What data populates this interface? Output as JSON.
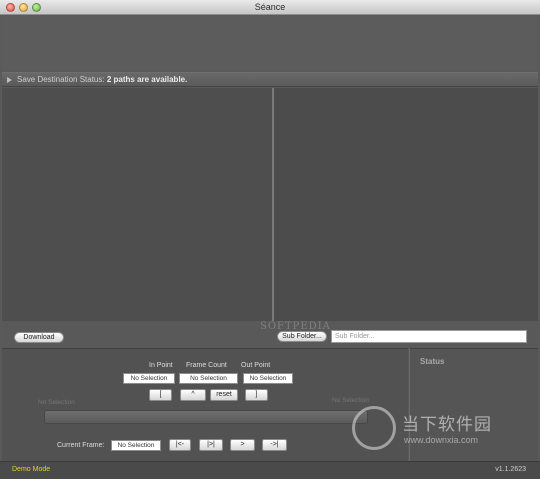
{
  "window": {
    "title": "Séance"
  },
  "status": {
    "label": "Save Destination Status:",
    "value": "2 paths are available."
  },
  "toolbar": {
    "download_label": "Download",
    "subfolder_button": "Sub Folder...",
    "subfolder_placeholder": "Sub Folder...",
    "watermark": "SOFTPEDIA"
  },
  "controls": {
    "in_point_label": "In Point",
    "frame_count_label": "Frame Count",
    "out_point_label": "Out Point",
    "in_point_value": "No Selection",
    "frame_count_value": "No Selection",
    "out_point_value": "No Selection",
    "mark_in": "[",
    "up": "^",
    "reset": "reset",
    "mark_out": "]",
    "timeline_left_label": "No Selection",
    "timeline_right_label": "No Selection",
    "current_frame_label": "Current Frame:",
    "current_frame_value": "No Selection",
    "go_start": "|<-",
    "play_pause": "|>|",
    "next": ">",
    "go_end": "->|"
  },
  "status_panel": {
    "title": "Status"
  },
  "footer": {
    "mode": "Demo Mode",
    "version": "v1.1.2623"
  },
  "corner_logo": {
    "text": "当下软件园",
    "url": "www.downxia.com"
  },
  "colors": {
    "demo_mode": "#e4d321",
    "background": "#5a5a5a"
  }
}
